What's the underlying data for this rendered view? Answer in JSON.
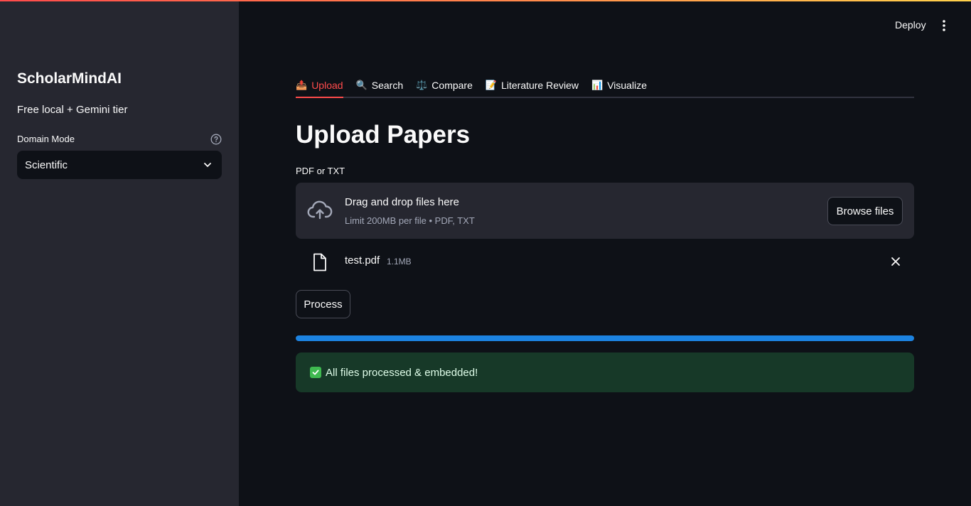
{
  "sidebar": {
    "app_title": "ScholarMindAI",
    "subtitle": "Free local + Gemini tier",
    "domain_mode_label": "Domain Mode",
    "domain_mode_value": "Scientific"
  },
  "header": {
    "deploy_label": "Deploy"
  },
  "tabs": [
    {
      "icon": "📤",
      "label": "Upload",
      "active": true
    },
    {
      "icon": "🔍",
      "label": "Search",
      "active": false
    },
    {
      "icon": "⚖️",
      "label": "Compare",
      "active": false
    },
    {
      "icon": "📝",
      "label": "Literature Review",
      "active": false
    },
    {
      "icon": "📊",
      "label": "Visualize",
      "active": false
    }
  ],
  "main": {
    "page_title": "Upload Papers",
    "uploader": {
      "label": "PDF or TXT",
      "drop_title": "Drag and drop files here",
      "limit_text": "Limit 200MB per file • PDF, TXT",
      "browse_label": "Browse files"
    },
    "file": {
      "name": "test.pdf",
      "size": "1.1MB"
    },
    "process_label": "Process",
    "progress_fraction": 1.0,
    "success_message": "All files processed & embedded!"
  },
  "colors": {
    "accent": "#ff4b4b",
    "progress": "#1c83e1",
    "success_bg": "#173928",
    "sidebar_bg": "#262730",
    "main_bg": "#0e1117"
  }
}
